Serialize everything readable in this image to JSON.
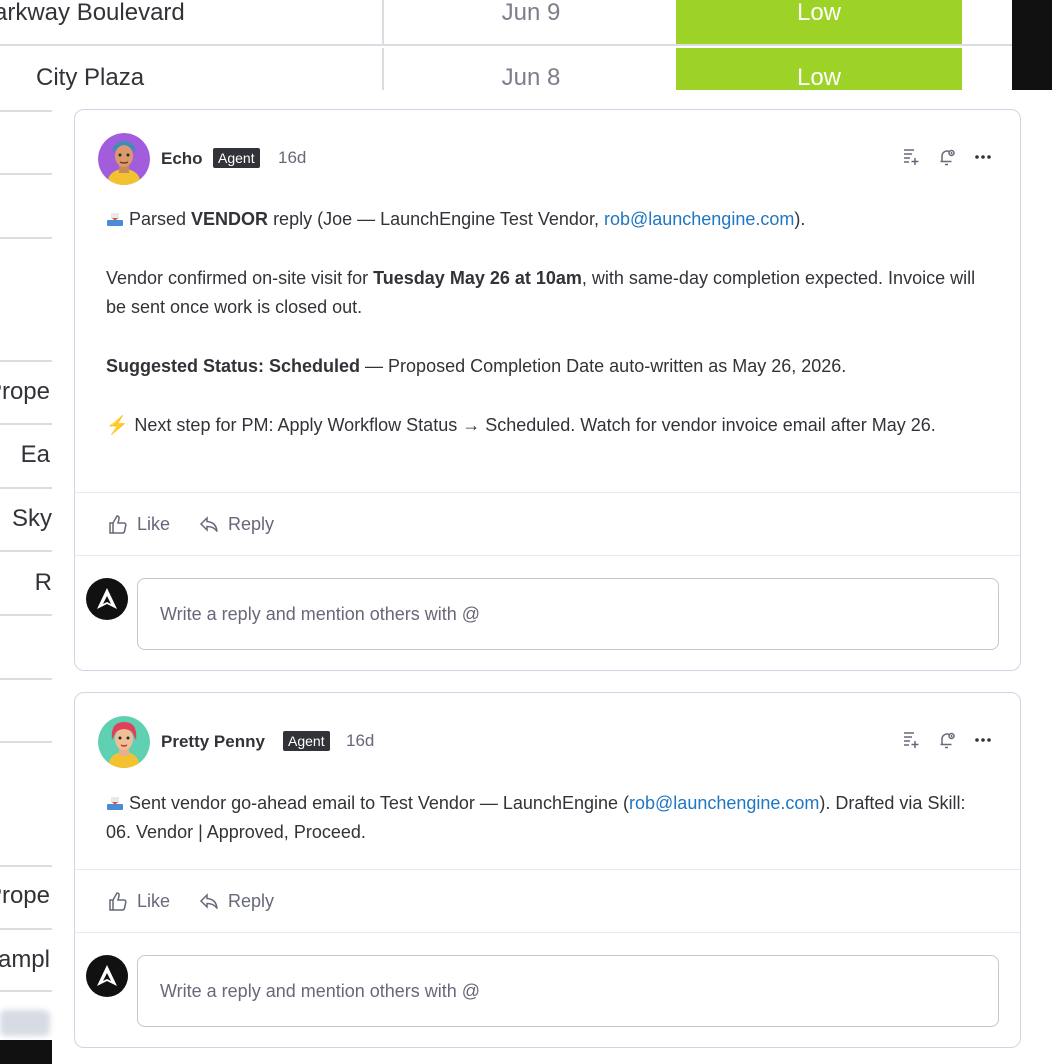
{
  "bg_table": {
    "rows": [
      {
        "name": "arkway Boulevard",
        "date": "Jun 9",
        "priority": "Low"
      },
      {
        "name": "City Plaza",
        "date": "Jun 8",
        "priority": "Low"
      }
    ],
    "left_fragments": [
      "Prope",
      "Ea",
      "Sky",
      "R",
      "Prope",
      "ampl"
    ]
  },
  "comments": [
    {
      "author": "Echo",
      "badge": "Agent",
      "time": "16d",
      "line1_pre": "Parsed ",
      "line1_bold": "VENDOR",
      "line1_mid": " reply (Joe — LaunchEngine Test Vendor, ",
      "line1_link": "rob@launchengine.com",
      "line1_post": ").",
      "p2_pre": "Vendor confirmed on-site visit for ",
      "p2_bold": "Tuesday May 26 at 10am",
      "p2_post": ", with same-day completion expected. Invoice will be sent once work is closed out.",
      "p3_bold": "Suggested Status: Scheduled",
      "p3_post": " — Proposed Completion Date auto-written as May 26, 2026.",
      "p4_icon": "⚡",
      "p4": "Next step for PM: Apply Workflow Status → Scheduled. Watch for vendor invoice email after May 26.",
      "like_label": "Like",
      "reply_label": "Reply",
      "reply_placeholder": "Write a reply and mention others with @"
    },
    {
      "author": "Pretty Penny",
      "badge": "Agent",
      "time": "16d",
      "line1_pre": "Sent vendor go-ahead email to Test Vendor — LaunchEngine (",
      "line1_link": "rob@launchengine.com",
      "line1_post": "). Drafted via Skill: 06. Vendor | Approved, Proceed.",
      "like_label": "Like",
      "reply_label": "Reply",
      "reply_placeholder": "Write a reply and mention others with @"
    }
  ],
  "icons": {
    "header": [
      "add-to-doc-icon",
      "bell-icon",
      "more-icon"
    ],
    "actions": [
      "thumbs-up-icon",
      "reply-arrow-icon"
    ]
  },
  "colors": {
    "priority_low": "#9cd326",
    "link": "#1f76c2",
    "badge_bg": "#323338"
  }
}
